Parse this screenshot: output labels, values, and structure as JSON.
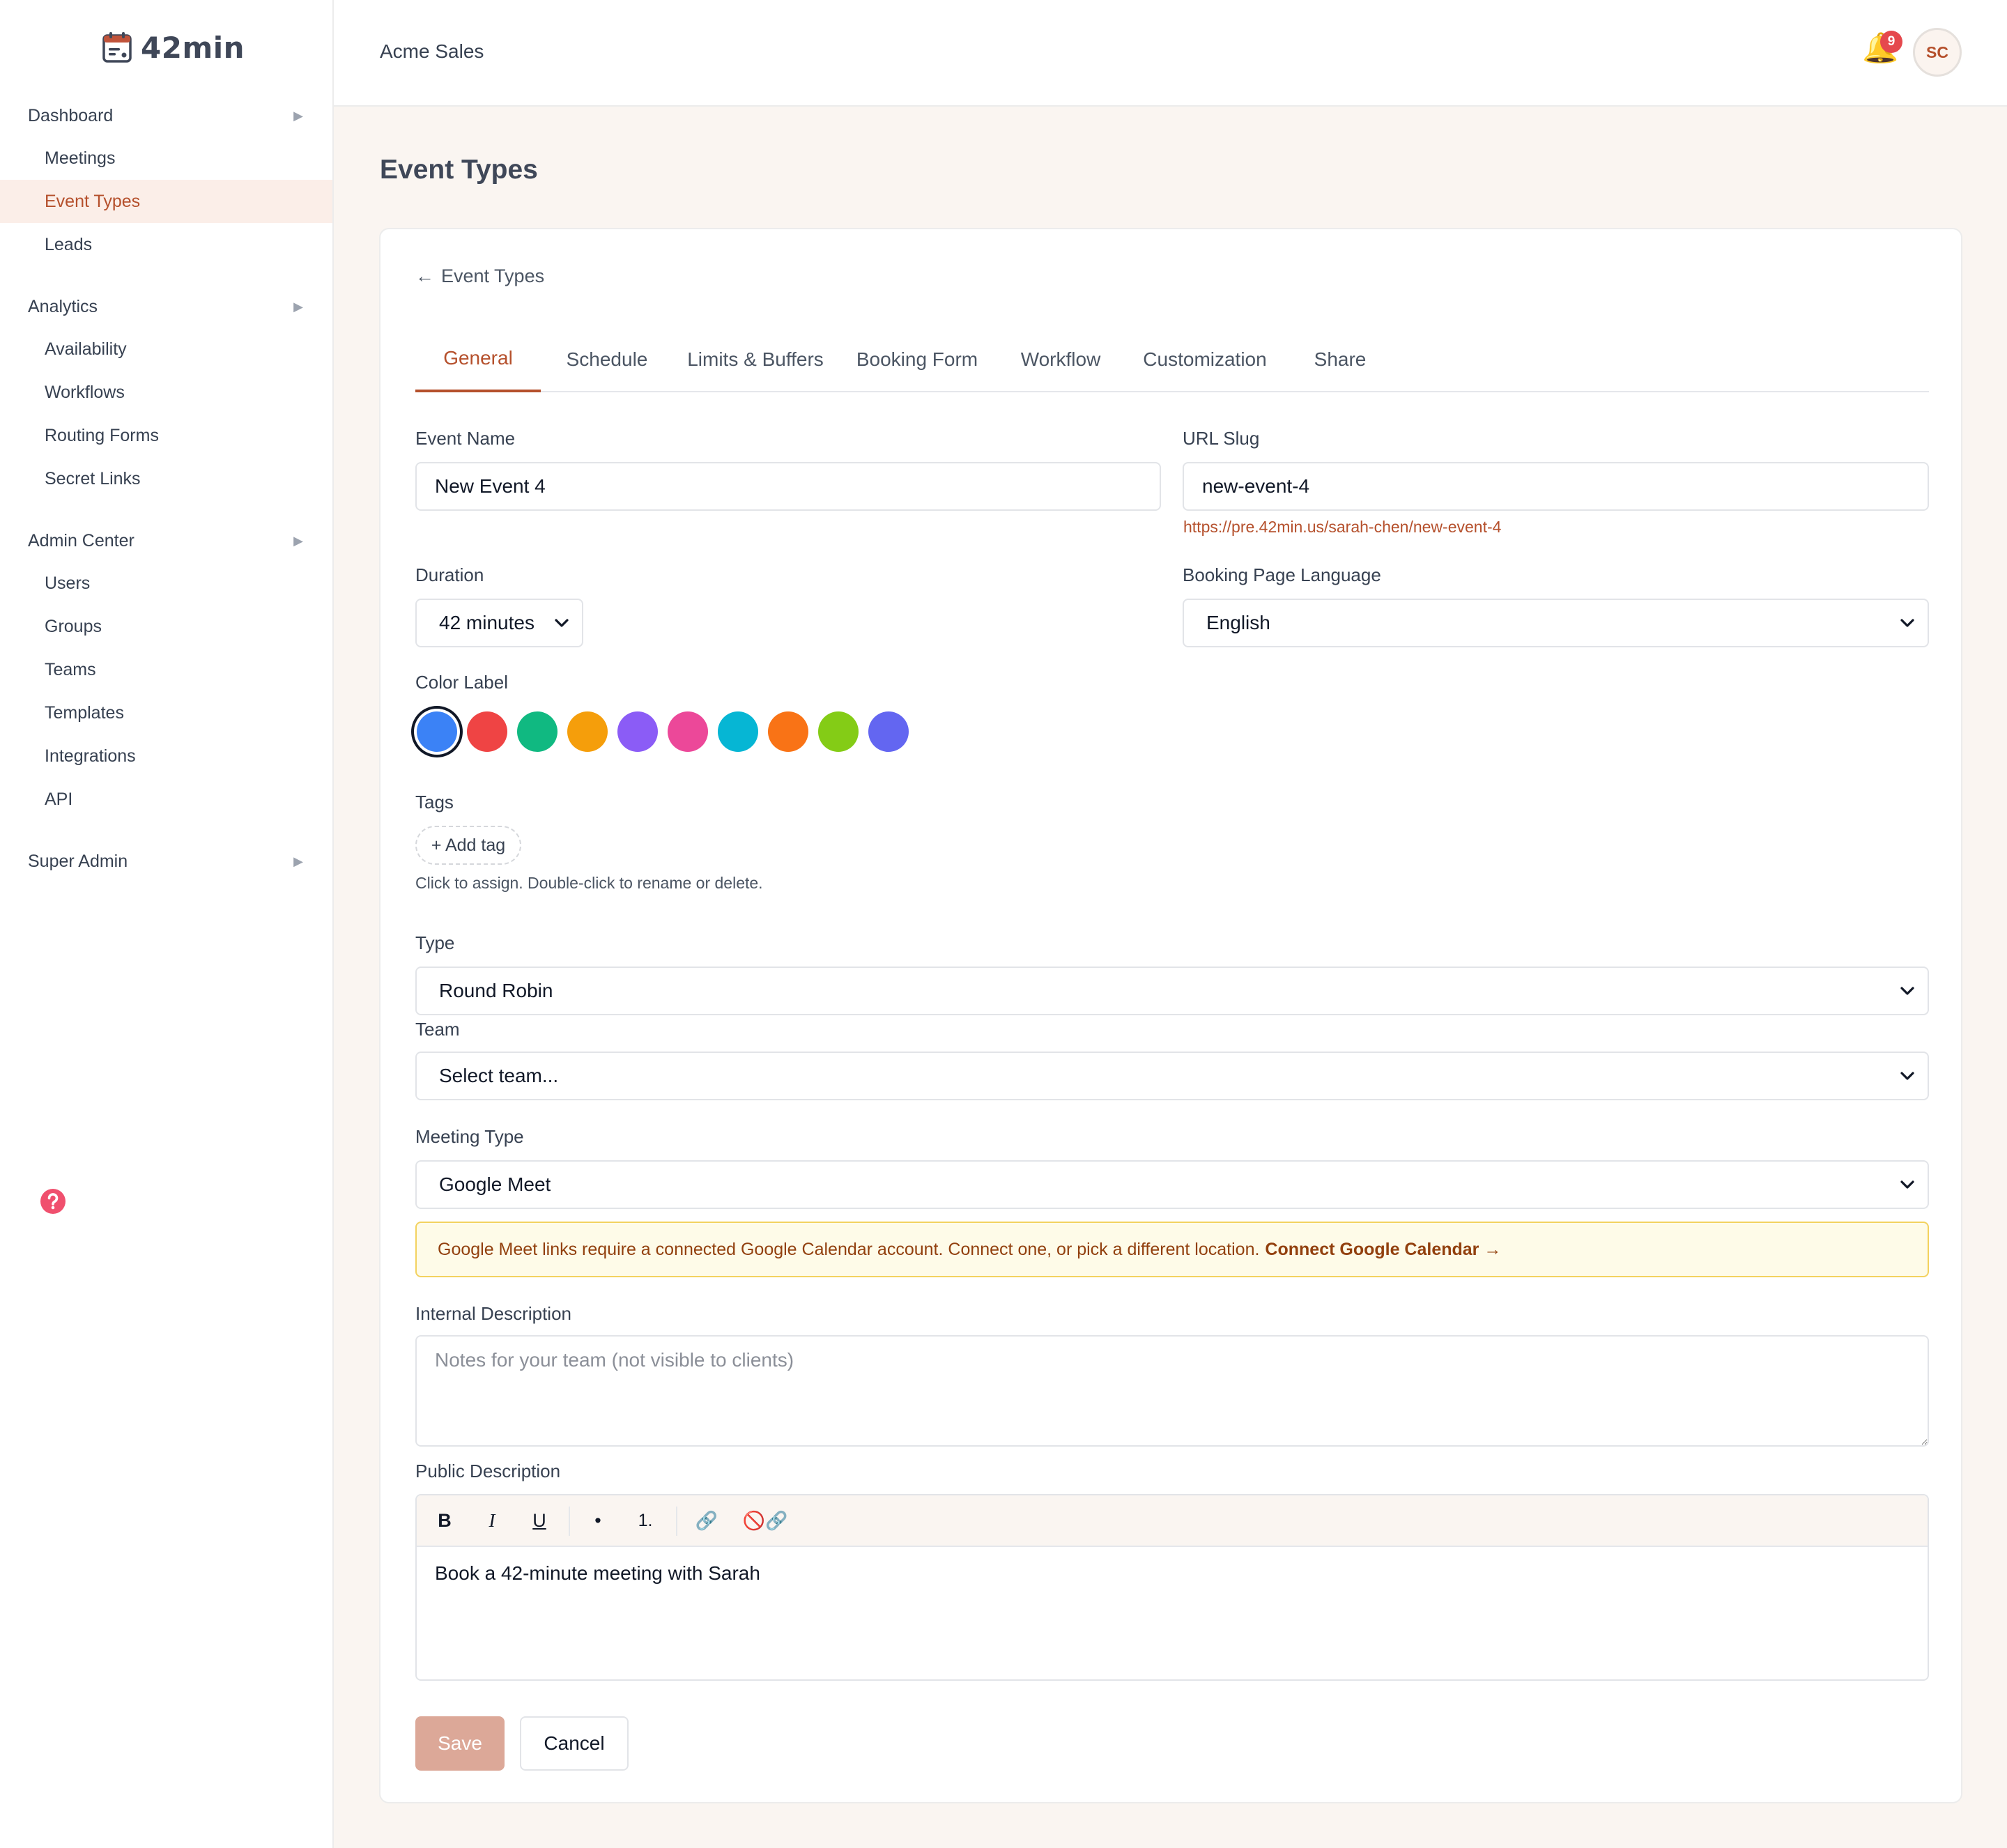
{
  "brand": {
    "name": "42min"
  },
  "sidebar": {
    "sections": [
      {
        "label": "Dashboard",
        "items": [
          "Meetings",
          "Event Types",
          "Leads"
        ]
      },
      {
        "label": "Analytics",
        "items": [
          "Availability",
          "Workflows",
          "Routing Forms",
          "Secret Links"
        ]
      },
      {
        "label": "Admin Center",
        "items": [
          "Users",
          "Groups",
          "Teams",
          "Templates",
          "Integrations",
          "API"
        ]
      },
      {
        "label": "Super Admin",
        "items": []
      }
    ],
    "active_item": "Event Types",
    "arrow_glyph": "▶"
  },
  "header": {
    "org_name": "Acme Sales",
    "notification_count": "9",
    "avatar_initials": "SC"
  },
  "page": {
    "title": "Event Types"
  },
  "card": {
    "back_arrow": "←",
    "back_label": "Event Types",
    "tabs": [
      "General",
      "Schedule",
      "Limits & Buffers",
      "Booking Form",
      "Workflow",
      "Customization",
      "Share"
    ],
    "active_tab": "General"
  },
  "form": {
    "event_name": {
      "label": "Event Name",
      "value": "New Event 4"
    },
    "url_slug": {
      "label": "URL Slug",
      "value": "new-event-4",
      "preview_url": "https://pre.42min.us/sarah-chen/new-event-4"
    },
    "duration": {
      "label": "Duration",
      "value": "42 minutes"
    },
    "language": {
      "label": "Booking Page Language",
      "value": "English"
    },
    "color_label": {
      "label": "Color Label",
      "colors": [
        "#3b82f6",
        "#ef4444",
        "#10b981",
        "#f59e0b",
        "#8b5cf6",
        "#ec4899",
        "#06b6d4",
        "#f97316",
        "#84cc16",
        "#6366f1"
      ],
      "selected_index": 0
    },
    "tags": {
      "label": "Tags",
      "add_label": "+ Add tag",
      "hint": "Click to assign. Double-click to rename or delete."
    },
    "type": {
      "label": "Type",
      "value": "Round Robin"
    },
    "team": {
      "label": "Team",
      "value": "Select team..."
    },
    "meeting_type": {
      "label": "Meeting Type",
      "value": "Google Meet"
    },
    "warning": {
      "text": "Google Meet links require a connected Google Calendar account. Connect one, or pick a different location.",
      "link": "Connect Google Calendar →"
    },
    "internal_description": {
      "label": "Internal Description",
      "placeholder": "Notes for your team (not visible to clients)"
    },
    "public_description": {
      "label": "Public Description",
      "toolbar": {
        "bold": "B",
        "italic": "I",
        "underline": "U",
        "bullet": "•",
        "numbered": "1.",
        "link": "🔗",
        "unlink_a": "🚫",
        "unlink_b": "🔗"
      },
      "content": "Book a 42-minute meeting with Sarah"
    }
  },
  "actions": {
    "save": "Save",
    "cancel": "Cancel"
  },
  "colors": {
    "accent": "#b5502c",
    "save_disabled": "#dca898",
    "warning_bg": "#fefbe8",
    "warning_border": "#f3d25f"
  }
}
